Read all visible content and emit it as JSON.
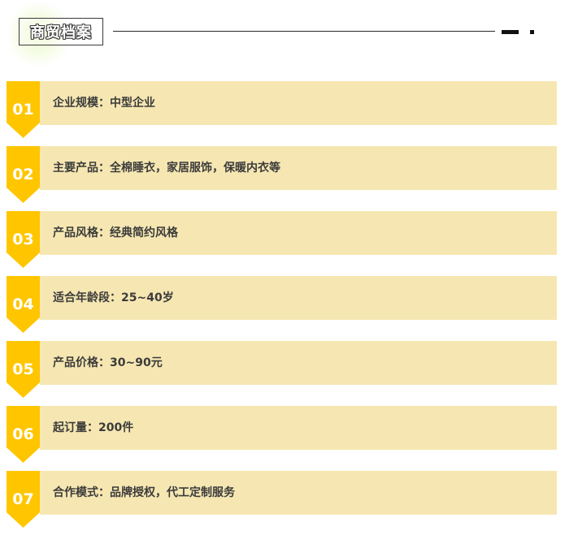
{
  "header": {
    "title": "商贸档案"
  },
  "items": [
    {
      "number": "01",
      "text": "企业规模：中型企业"
    },
    {
      "number": "02",
      "text": "主要产品：全棉睡衣，家居服饰，保暖内衣等"
    },
    {
      "number": "03",
      "text": "产品风格：经典简约风格"
    },
    {
      "number": "04",
      "text": "适合年龄段：25~40岁"
    },
    {
      "number": "05",
      "text": "产品价格：30~90元"
    },
    {
      "number": "06",
      "text": "起订量：200件"
    },
    {
      "number": "07",
      "text": "合作模式：品牌授权，代工定制服务"
    }
  ],
  "colors": {
    "badge": "#ffc600",
    "bar": "#f6e7b2",
    "text": "#3b3b3b"
  }
}
